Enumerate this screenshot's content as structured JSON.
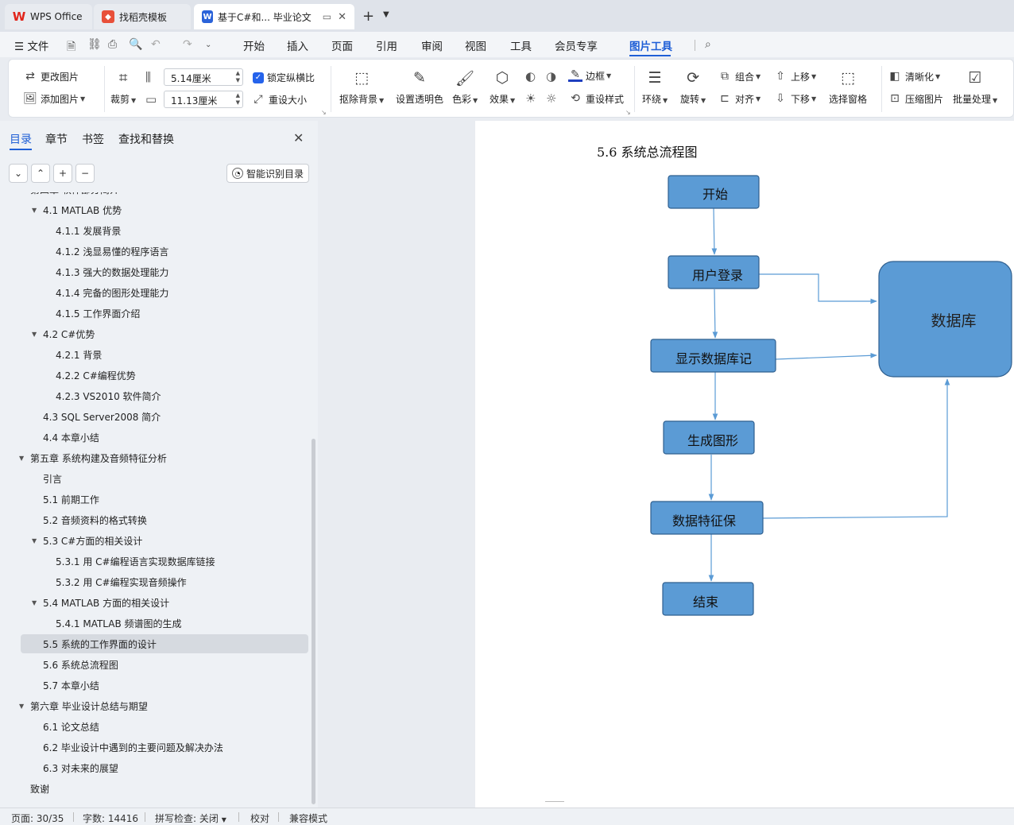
{
  "tabs": {
    "wps": "WPS Office",
    "template": "找稻壳模板",
    "document": "基于C#和... 毕业论文"
  },
  "menu": {
    "file": "文件",
    "items": [
      "开始",
      "插入",
      "页面",
      "引用",
      "审阅",
      "视图",
      "工具",
      "会员专享",
      "图片工具"
    ],
    "active": "图片工具"
  },
  "ribbon": {
    "change_image": "更改图片",
    "add_image": "添加图片",
    "crop": "裁剪",
    "width_value": "5.14厘米",
    "height_value": "11.13厘米",
    "lock_ratio": "锁定纵横比",
    "reset_size": "重设大小",
    "remove_bg": "抠除背景",
    "set_transparent": "设置透明色",
    "color": "色彩",
    "effect": "效果",
    "border": "边框",
    "reset_style": "重设样式",
    "wrap": "环绕",
    "rotate": "旋转",
    "group": "组合",
    "align": "对齐",
    "bring_up": "上移",
    "send_down": "下移",
    "selection_pane": "选择窗格",
    "sharpen": "清晰化",
    "compress": "压缩图片",
    "batch": "批量处理"
  },
  "left_panel": {
    "tabs": [
      "目录",
      "章节",
      "书签",
      "查找和替换"
    ],
    "smart_toc": "智能识别目录",
    "toc": [
      {
        "text": "第四章  软件部分简介",
        "level": 0,
        "arrow": true
      },
      {
        "text": "4.1 MATLAB 优势",
        "level": 1,
        "arrow": true
      },
      {
        "text": "4.1.1 发展背景",
        "level": 2
      },
      {
        "text": "4.1.2  浅显易懂的程序语言",
        "level": 2
      },
      {
        "text": "4.1.3  强大的数据处理能力",
        "level": 2
      },
      {
        "text": "4.1.4  完备的图形处理能力",
        "level": 2
      },
      {
        "text": "4.1.5  工作界面介绍",
        "level": 2
      },
      {
        "text": "4.2 C#优势",
        "level": 1,
        "arrow": true
      },
      {
        "text": "4.2.1 背景",
        "level": 2
      },
      {
        "text": "4.2.2 C#编程优势",
        "level": 2
      },
      {
        "text": "4.2.3 VS2010 软件简介",
        "level": 2
      },
      {
        "text": "4.3 SQL Server2008 简介",
        "level": 1
      },
      {
        "text": "4.4  本章小结",
        "level": 1
      },
      {
        "text": "第五章  系统构建及音频特征分析",
        "level": 0,
        "arrow": true
      },
      {
        "text": "引言",
        "level": 1
      },
      {
        "text": "5.1  前期工作",
        "level": 1
      },
      {
        "text": "5.2  音频资料的格式转换",
        "level": 1
      },
      {
        "text": "5.3 C#方面的相关设计",
        "level": 1,
        "arrow": true
      },
      {
        "text": "5.3.1 用 C#编程语言实现数据库链接",
        "level": 2
      },
      {
        "text": "5.3.2  用 C#编程实现音频操作",
        "level": 2
      },
      {
        "text": "5.4 MATLAB 方面的相关设计",
        "level": 1,
        "arrow": true
      },
      {
        "text": "5.4.1 MATLAB 频谱图的生成",
        "level": 2
      },
      {
        "text": "5.5 系统的工作界面的设计",
        "level": 1,
        "selected": true
      },
      {
        "text": "5.6  系统总流程图",
        "level": 1
      },
      {
        "text": "5.7  本章小结",
        "level": 1
      },
      {
        "text": "第六章  毕业设计总结与期望",
        "level": 0,
        "arrow": true
      },
      {
        "text": "6.1 论文总结",
        "level": 1
      },
      {
        "text": "6.2  毕业设计中遇到的主要问题及解决办法",
        "level": 1
      },
      {
        "text": "6.3  对未来的展望",
        "level": 1
      },
      {
        "text": "致谢",
        "level": 0
      }
    ]
  },
  "document": {
    "section_title": "5.6  系统总流程图",
    "flowchart": {
      "nodes": {
        "start": "开始",
        "login": "用户登录",
        "display": "显示数据库记",
        "generate": "生成图形",
        "save": "数据特征保",
        "end": "结束",
        "database": "数据库"
      }
    }
  },
  "status": {
    "page": "页面: 30/35",
    "words": "字数: 14416",
    "spell": "拼写检查: 关闭",
    "proof": "校对",
    "compat": "兼容模式"
  }
}
